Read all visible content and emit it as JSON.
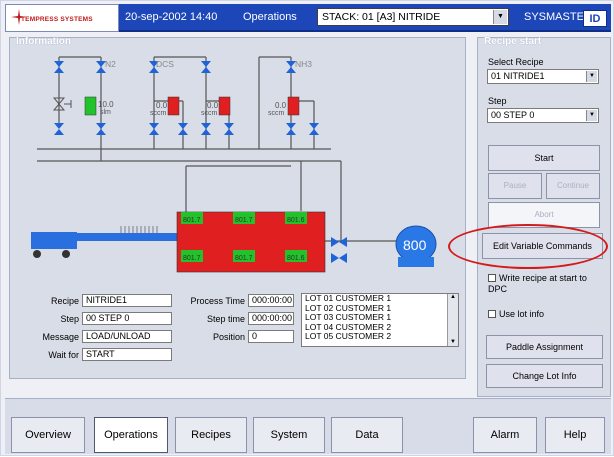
{
  "header": {
    "logo_text": "TEMPRESS SYSTEMS",
    "datetime": "20-sep-2002 14:40",
    "section": "Operations",
    "stack": "STACK: 01 [A3] NITRIDE",
    "user": "SYSMASTER",
    "id_label": "ID"
  },
  "information": {
    "title": "Information",
    "gases": [
      "N2",
      "DCS",
      "NH3"
    ],
    "flows": [
      {
        "value": "10.0",
        "unit": "slm",
        "color": "#22c22a"
      },
      {
        "value": "0.0",
        "unit": "sccm",
        "color": "#e02020"
      },
      {
        "value": "0.0",
        "unit": "sccm",
        "color": "#e02020"
      },
      {
        "value": "0.0",
        "unit": "sccm",
        "color": "#e02020"
      }
    ],
    "zones_top": [
      "801.7",
      "801.7",
      "801.6"
    ],
    "zones_bottom": [
      "801.7",
      "801.7",
      "801.6"
    ],
    "pump_value": "800",
    "fields": {
      "recipe_label": "Recipe",
      "recipe": "NITRIDE1",
      "step_label": "Step",
      "step": "00 STEP 0",
      "message_label": "Message",
      "message": "LOAD/UNLOAD",
      "waitfor_label": "Wait for",
      "waitfor": "START",
      "process_time_label": "Process Time",
      "process_time": "000:00:00",
      "step_time_label": "Step time",
      "step_time": "000:00:00",
      "position_label": "Position",
      "position": "0"
    },
    "lots": [
      "LOT 01 CUSTOMER 1",
      "LOT 02 CUSTOMER 1",
      "LOT 03 CUSTOMER 1",
      "LOT 04 CUSTOMER 2",
      "LOT 05 CUSTOMER 2"
    ]
  },
  "recipe_start": {
    "title": "Recipe start",
    "select_recipe_label": "Select Recipe",
    "selected_recipe": "01 NITRIDE1",
    "step_label": "Step",
    "selected_step": "00 STEP 0",
    "start": "Start",
    "pause": "Pause",
    "continue": "Continue",
    "abort": "Abort",
    "edit_variable_commands": "Edit Variable Commands",
    "write_recipe": "Write recipe at start to DPC",
    "use_lot_info": "Use lot info",
    "paddle_assignment": "Paddle Assignment",
    "change_lot_info": "Change Lot Info"
  },
  "nav": {
    "overview": "Overview",
    "operations": "Operations",
    "recipes": "Recipes",
    "system": "System",
    "data": "Data",
    "alarm": "Alarm",
    "help": "Help"
  },
  "colors": {
    "header_blue": "#1d47b8",
    "flow_ok": "#22c22a",
    "flow_off": "#e02020",
    "furnace": "#e02020",
    "valve_blue": "#1f63d9",
    "pump_blue": "#2a78e6",
    "highlight": "#d31b1b"
  }
}
